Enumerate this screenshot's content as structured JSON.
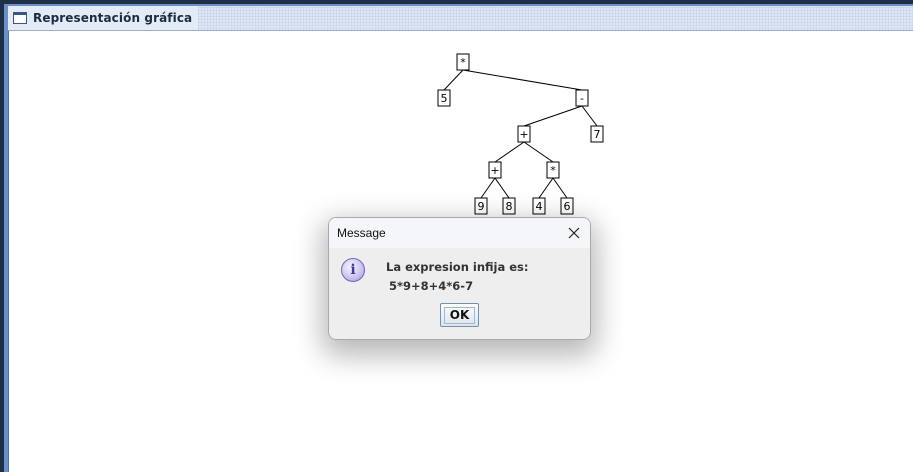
{
  "window": {
    "title": "Representación gráfica",
    "icon": "window-icon"
  },
  "tree": {
    "nodes": [
      {
        "id": "n1",
        "label": "*"
      },
      {
        "id": "n2",
        "label": "5"
      },
      {
        "id": "n3",
        "label": "-"
      },
      {
        "id": "n4",
        "label": "+"
      },
      {
        "id": "n5",
        "label": "7"
      },
      {
        "id": "n6",
        "label": "+"
      },
      {
        "id": "n7",
        "label": "*"
      },
      {
        "id": "n8",
        "label": "9"
      },
      {
        "id": "n9",
        "label": "8"
      },
      {
        "id": "n10",
        "label": "4"
      },
      {
        "id": "n11",
        "label": "6"
      }
    ],
    "edges": [
      [
        "n1",
        "n2"
      ],
      [
        "n1",
        "n3"
      ],
      [
        "n3",
        "n4"
      ],
      [
        "n3",
        "n5"
      ],
      [
        "n4",
        "n6"
      ],
      [
        "n4",
        "n7"
      ],
      [
        "n6",
        "n8"
      ],
      [
        "n6",
        "n9"
      ],
      [
        "n7",
        "n10"
      ],
      [
        "n7",
        "n11"
      ]
    ]
  },
  "dialog": {
    "title": "Message",
    "icon": "info-icon",
    "message_line1": "La expresion infija es:",
    "message_line2": "5*9+8+4*6-7",
    "ok_label": "OK",
    "close_icon": "close-icon"
  }
}
